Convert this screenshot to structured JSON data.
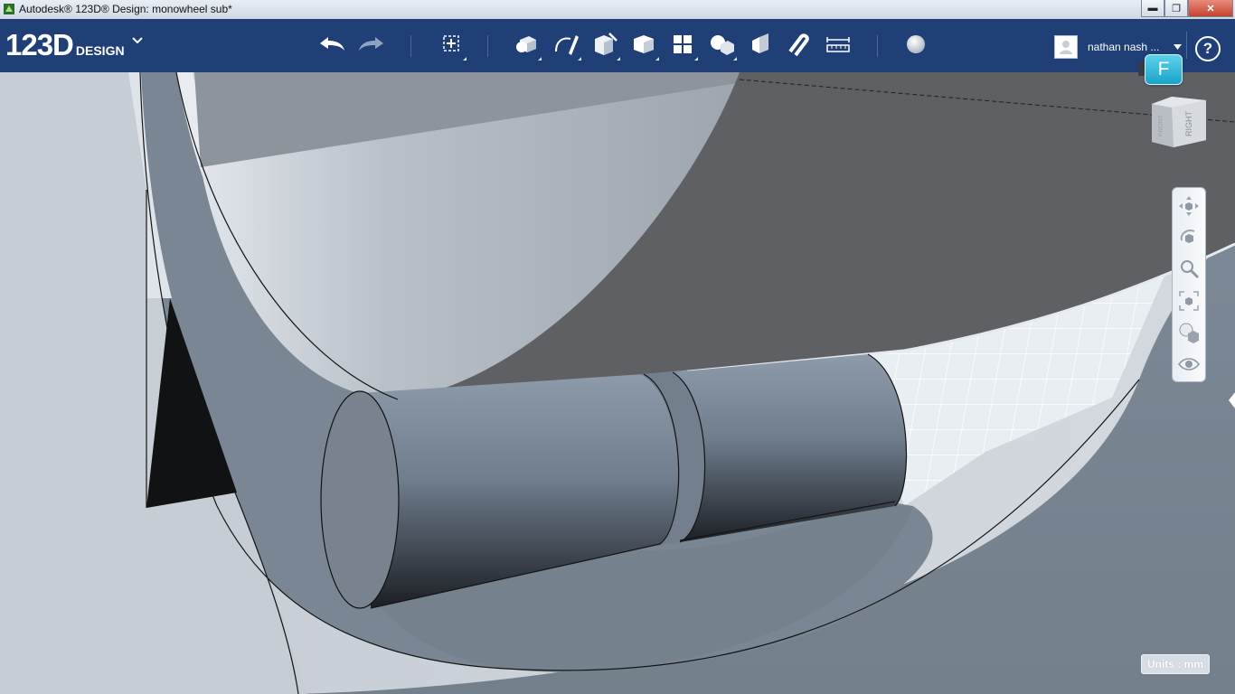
{
  "window": {
    "title": "Autodesk® 123D® Design: monowheel sub*",
    "min_label": "▬",
    "max_label": "❐",
    "close_label": "✕"
  },
  "logo": {
    "main": "123D",
    "sub": "DESIGN"
  },
  "toolbar": {
    "tools": [
      {
        "name": "undo-button",
        "icon": "undo-icon"
      },
      {
        "name": "redo-button",
        "icon": "redo-icon"
      },
      {
        "name": "transform-button",
        "icon": "transform-icon"
      },
      {
        "name": "primitives-button",
        "icon": "primitives-icon"
      },
      {
        "name": "sketch-button",
        "icon": "sketch-icon"
      },
      {
        "name": "construct-button",
        "icon": "construct-icon"
      },
      {
        "name": "modify-button",
        "icon": "modify-icon"
      },
      {
        "name": "pattern-button",
        "icon": "pattern-icon"
      },
      {
        "name": "grouping-button",
        "icon": "grouping-icon"
      },
      {
        "name": "combine-button",
        "icon": "combine-icon"
      },
      {
        "name": "snap-button",
        "icon": "snap-icon"
      },
      {
        "name": "measure-button",
        "icon": "measure-icon"
      },
      {
        "name": "material-button",
        "icon": "material-sphere-icon"
      }
    ]
  },
  "user": {
    "name": "nathan nash ...",
    "help_label": "?"
  },
  "badge": {
    "label": "F",
    "color": "#29b6d8"
  },
  "view_cube": {
    "face_label": "RIGHT",
    "side_label": "FRONT"
  },
  "nav": {
    "items": [
      "pan-icon",
      "orbit-icon",
      "zoom-icon",
      "fit-icon",
      "view-mode-icon",
      "visibility-icon"
    ]
  },
  "units": {
    "label": "Units : mm"
  },
  "colors": {
    "toolbar_bg": "#1f3f76",
    "model_gray": "#7a8593",
    "grid_bg": "#e8edf2"
  }
}
